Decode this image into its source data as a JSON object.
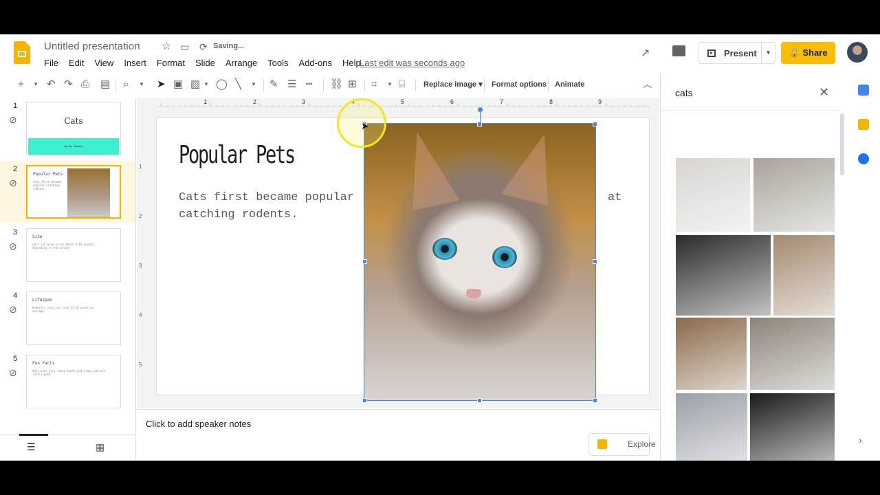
{
  "app": {
    "title": "Untitled presentation",
    "status": "Saving...",
    "last_edit": "Last edit was seconds ago",
    "present_label": "Present",
    "share_label": "Share"
  },
  "menu": [
    "File",
    "Edit",
    "View",
    "Insert",
    "Format",
    "Slide",
    "Arrange",
    "Tools",
    "Add-ons",
    "Help"
  ],
  "toolbar": {
    "replace_image": "Replace image",
    "format_options": "Format options",
    "animate": "Animate"
  },
  "ruler": {
    "h_ticks": [
      "1",
      "2",
      "3",
      "4",
      "5",
      "6",
      "7",
      "8",
      "9"
    ],
    "v_ticks": [
      "1",
      "2",
      "3",
      "4",
      "5"
    ]
  },
  "slides": [
    {
      "num": "1",
      "title": "Cats",
      "subtitle": "By Ms. Walters"
    },
    {
      "num": "2",
      "title": "Popular Pets",
      "body": "Cats first became popular catching rodents."
    },
    {
      "num": "3",
      "title": "Size",
      "body": "Cats can grow to be about 4-16 pounds, depending on the breed."
    },
    {
      "num": "4",
      "title": "Lifespan",
      "body": "Domestic cats can live 12-18 years on average."
    },
    {
      "num": "5",
      "title": "Fun Facts",
      "body": "Cats have very sharp teeth and claws and are intelligent."
    }
  ],
  "current_slide": {
    "title": "Popular Pets",
    "body_line1_left": "Cats first became popular",
    "body_line1_right": "at",
    "body_line2": "catching rodents."
  },
  "notes_placeholder": "Click to add speaker notes",
  "explore_label": "Explore",
  "image_search": {
    "query": "cats",
    "results": [
      {
        "name": "result-white-cat",
        "color": "#d9d4d0"
      },
      {
        "name": "result-cat-on-wall",
        "color": "#a9a39a"
      },
      {
        "name": "result-black-white-cats",
        "color": "#2a2a2a"
      },
      {
        "name": "result-kitten",
        "color": "#a48a70"
      },
      {
        "name": "result-tabby-close",
        "color": "#8a6a4a"
      },
      {
        "name": "result-tabby-sitting",
        "color": "#8c8478"
      },
      {
        "name": "result-gray-cat",
        "color": "#9aa0a8"
      },
      {
        "name": "result-tabby-black-bg",
        "color": "#1a1a1a"
      },
      {
        "name": "result-orange-cat",
        "color": "#c88a50"
      },
      {
        "name": "result-dark-cat",
        "color": "#6a6a70"
      }
    ]
  },
  "colors": {
    "accent": "#fbbc04",
    "selection": "#4285f4",
    "thumb_active": "#fef7e0",
    "teal_bar": "#3cf0d0"
  }
}
